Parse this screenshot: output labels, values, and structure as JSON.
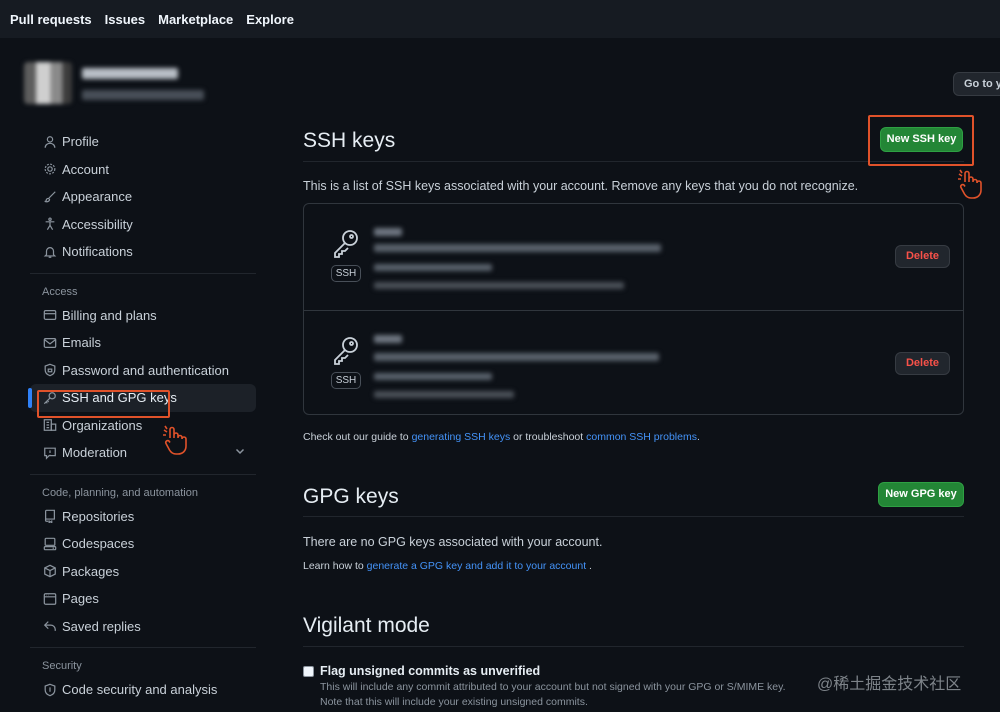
{
  "topnav": {
    "items": [
      "Pull requests",
      "Issues",
      "Marketplace",
      "Explore"
    ]
  },
  "header": {
    "goto_button": "Go to y"
  },
  "sidebar": {
    "items_top": [
      {
        "label": "Profile",
        "icon": "person-icon"
      },
      {
        "label": "Account",
        "icon": "gear-icon"
      },
      {
        "label": "Appearance",
        "icon": "paintbrush-icon"
      },
      {
        "label": "Accessibility",
        "icon": "accessibility-icon"
      },
      {
        "label": "Notifications",
        "icon": "bell-icon"
      }
    ],
    "access_heading": "Access",
    "items_access": [
      {
        "label": "Billing and plans",
        "icon": "credit-card-icon"
      },
      {
        "label": "Emails",
        "icon": "mail-icon"
      },
      {
        "label": "Password and authentication",
        "icon": "shield-lock-icon"
      },
      {
        "label": "SSH and GPG keys",
        "icon": "key-icon"
      },
      {
        "label": "Organizations",
        "icon": "organization-icon"
      },
      {
        "label": "Moderation",
        "icon": "report-icon"
      }
    ],
    "code_heading": "Code, planning, and automation",
    "items_code": [
      {
        "label": "Repositories",
        "icon": "repo-icon"
      },
      {
        "label": "Codespaces",
        "icon": "codespaces-icon"
      },
      {
        "label": "Packages",
        "icon": "package-icon"
      },
      {
        "label": "Pages",
        "icon": "browser-icon"
      },
      {
        "label": "Saved replies",
        "icon": "reply-icon"
      }
    ],
    "security_heading": "Security",
    "items_security": [
      {
        "label": "Code security and analysis",
        "icon": "codescan-icon"
      }
    ]
  },
  "ssh": {
    "title": "SSH keys",
    "new_button": "New SSH key",
    "description": "This is a list of SSH keys associated with your account. Remove any keys that you do not recognize.",
    "key_badge": "SSH",
    "delete_label": "Delete",
    "guide_prefix": "Check out our guide to ",
    "guide_link1": "generating SSH keys",
    "guide_middle": " or troubleshoot ",
    "guide_link2": "common SSH problems",
    "guide_suffix": "."
  },
  "gpg": {
    "title": "GPG keys",
    "new_button": "New GPG key",
    "empty_text": "There are no GPG keys associated with your account.",
    "learn_prefix": "Learn how to ",
    "learn_link": "generate a GPG key and add it to your account",
    "learn_suffix": " ."
  },
  "vigilant": {
    "title": "Vigilant mode",
    "checkbox_label": "Flag unsigned commits as unverified",
    "note1": "This will include any commit attributed to your account but not signed with your GPG or S/MIME key.",
    "note2": "Note that this will include your existing unsigned commits."
  },
  "watermark": "@稀土掘金技术社区",
  "colors": {
    "accent": "#2f81f7",
    "green": "#238636",
    "danger": "#f85149",
    "highlight": "#e0522a"
  }
}
